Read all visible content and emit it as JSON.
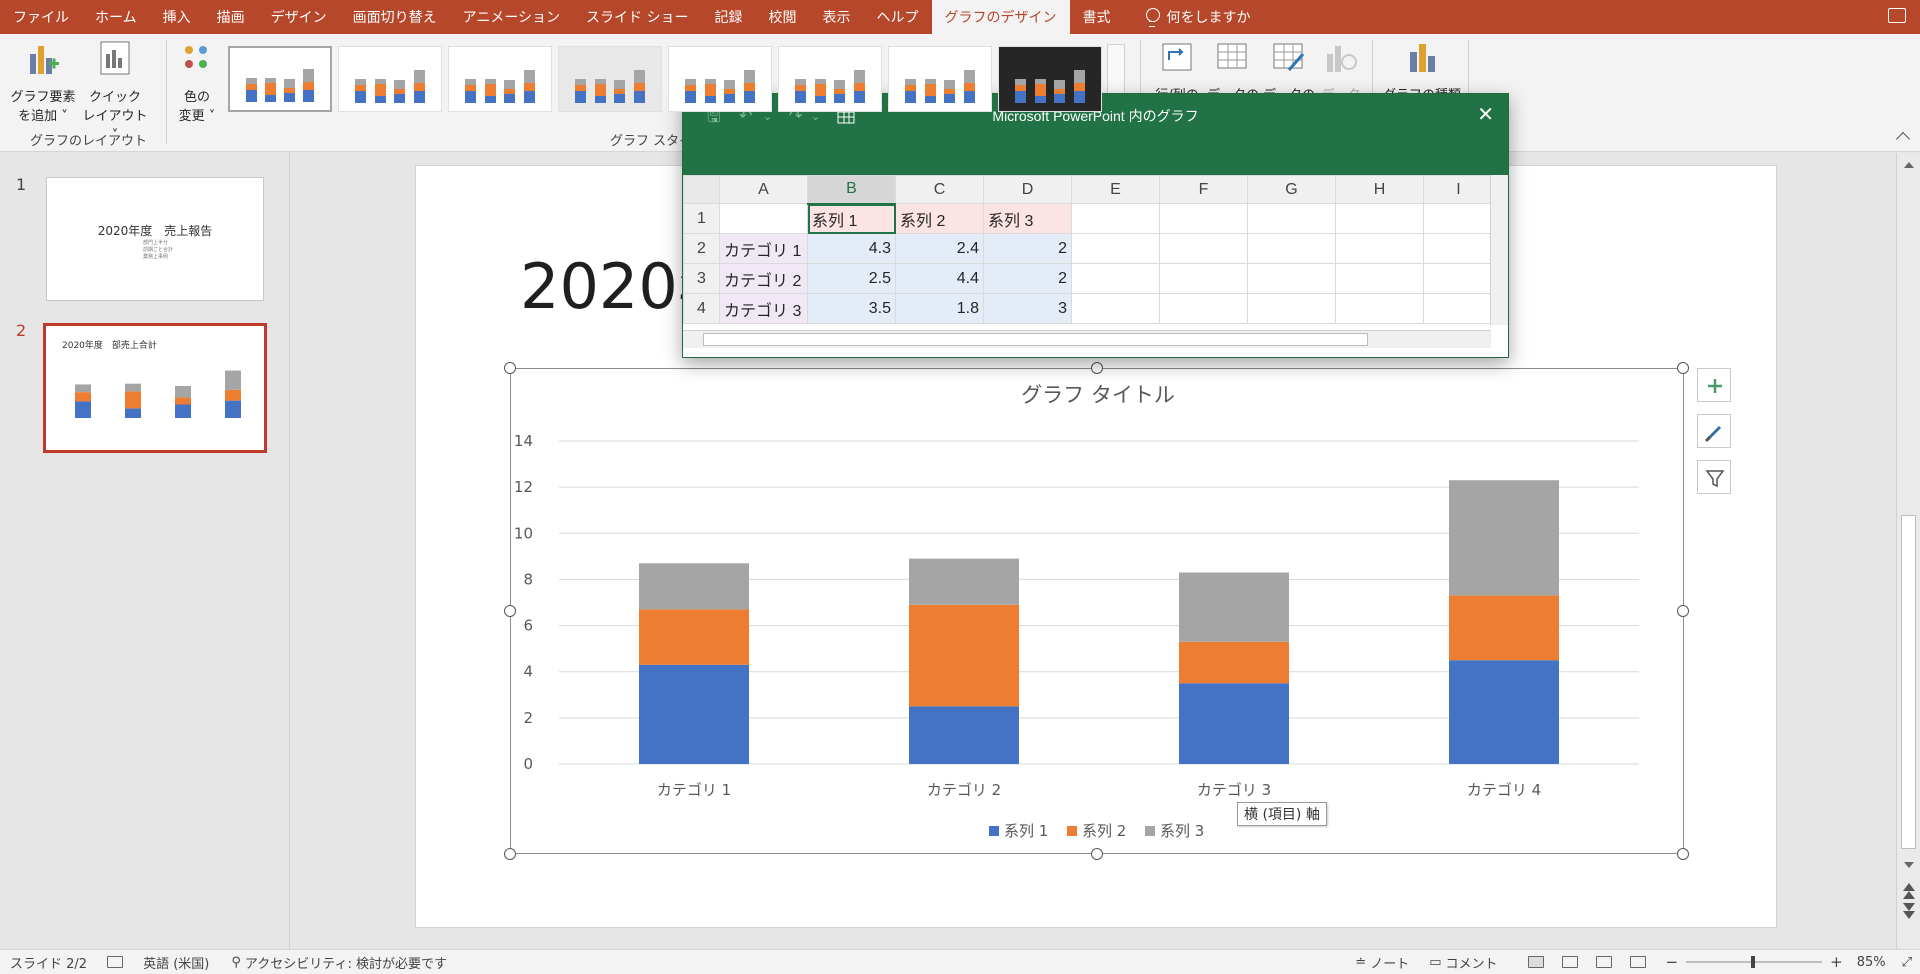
{
  "ribbon_tabs": [
    "ファイル",
    "ホーム",
    "挿入",
    "描画",
    "デザイン",
    "画面切り替え",
    "アニメーション",
    "スライド ショー",
    "記録",
    "校閲",
    "表示",
    "ヘルプ",
    "グラフのデザイン",
    "書式"
  ],
  "active_tab": "グラフのデザイン",
  "tell_me": "何をしますか",
  "ribbon": {
    "add_element": [
      "グラフ要素",
      "を追加 ˅"
    ],
    "quick_layout": [
      "クイック",
      "レイアウト ˅"
    ],
    "change_colors": [
      "色の",
      "変更 ˅"
    ],
    "group_layout": "グラフのレイアウト",
    "group_styles": "グラフ スタイル",
    "switch_row_col": "行/列の",
    "select_data": "データの",
    "edit_data": "データの",
    "refresh_data": "データ",
    "change_type": "グラフの種類"
  },
  "slides": {
    "numbers": [
      "1",
      "2"
    ],
    "thumb1": {
      "title": "2020年度　売上報告",
      "bullets": [
        "部門上半分",
        "前期ごと合計",
        "業務上事例"
      ]
    },
    "thumb2": {
      "title": "2020年度　部売上合計"
    }
  },
  "slide_title": "2020年",
  "sheet": {
    "window_title": "Microsoft PowerPoint 内のグラフ",
    "columns": [
      "A",
      "B",
      "C",
      "D",
      "E",
      "F",
      "G",
      "H",
      "I"
    ],
    "rows": [
      "1",
      "2",
      "3",
      "4"
    ],
    "header_row": [
      "",
      "系列 1",
      "系列 2",
      "系列 3"
    ],
    "data_rows": [
      [
        "カテゴリ 1",
        "4.3",
        "2.4",
        "2"
      ],
      [
        "カテゴリ 2",
        "2.5",
        "4.4",
        "2"
      ],
      [
        "カテゴリ 3",
        "3.5",
        "1.8",
        "3"
      ]
    ]
  },
  "chart_data": {
    "type": "bar",
    "stacked": true,
    "title": "グラフ タイトル",
    "categories": [
      "カテゴリ 1",
      "カテゴリ 2",
      "カテゴリ 3",
      "カテゴリ 4"
    ],
    "series": [
      {
        "name": "系列 1",
        "values": [
          4.3,
          2.5,
          3.5,
          4.5
        ],
        "color": "#4472c4"
      },
      {
        "name": "系列 2",
        "values": [
          2.4,
          4.4,
          1.8,
          2.8
        ],
        "color": "#ed7d31"
      },
      {
        "name": "系列 3",
        "values": [
          2,
          2,
          3,
          5
        ],
        "color": "#a5a5a5"
      }
    ],
    "ylim": [
      0,
      14
    ],
    "yticks": [
      "0",
      "2",
      "4",
      "6",
      "8",
      "10",
      "12",
      "14"
    ],
    "grid": true,
    "legend": "bottom"
  },
  "tooltip": "横 (項目) 軸",
  "status": {
    "slide": "スライド 2/2",
    "language": "英語 (米国)",
    "accessibility": "アクセシビリティ: 検討が必要です",
    "notes": "ノート",
    "comments": "コメント",
    "zoom": "85%"
  }
}
